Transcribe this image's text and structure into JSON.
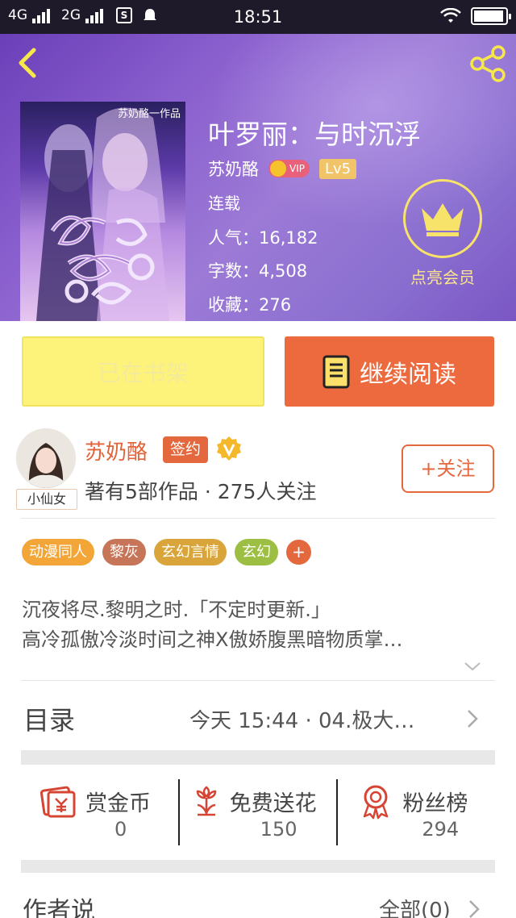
{
  "status_bar": {
    "network_1": "4G",
    "network_2": "2G",
    "sim_label": "S",
    "time": "18:51",
    "battery_level": 0.95
  },
  "book": {
    "title": "叶罗丽：与时沉浮",
    "author": "苏奶酪",
    "vip_label": "VIP",
    "level": "Lv5",
    "status": "连载",
    "popularity_label": "人气：16,182",
    "word_count_label": "字数：4,508",
    "favorites_label": "收藏：276",
    "cover": {
      "top_text": "苏奶酪一作品"
    }
  },
  "member": {
    "label": "点亮会员"
  },
  "buttons": {
    "shelf_label": "已在书架",
    "read_label": "继续阅读"
  },
  "author_card": {
    "avatar_tag": "小仙女",
    "name": "苏奶酪",
    "sign_label": "签约",
    "stats": "著有5部作品 · 275人关注",
    "follow_label": "+关注"
  },
  "tags": [
    {
      "label": "动漫同人",
      "color": "#f3a637"
    },
    {
      "label": "黎灰",
      "color": "#c77558"
    },
    {
      "label": "玄幻言情",
      "color": "#d9a43a"
    },
    {
      "label": "玄幻",
      "color": "#9cbf43"
    }
  ],
  "tag_more_label": "+",
  "synopsis": {
    "line1": "沉夜将尽.黎明之时.「不定时更新.」",
    "line2": "高冷孤傲冷淡时间之神X傲娇腹黑暗物质掌…"
  },
  "catalog": {
    "label": "目录",
    "latest": "今天 15:44 · 04.极大…"
  },
  "actions": [
    {
      "label": "赏金币",
      "count": "0",
      "icon": "coin-envelope-icon"
    },
    {
      "label": "免费送花",
      "count": "150",
      "icon": "flower-icon"
    },
    {
      "label": "粉丝榜",
      "count": "294",
      "icon": "medal-icon"
    }
  ],
  "author_says": {
    "label": "作者说",
    "all_label": "全部(0)"
  },
  "colors": {
    "accent": "#e4683d",
    "shelf_button": "#fdf37b",
    "header_purple": "#8a5fce",
    "member_gold": "#f7e26a"
  }
}
